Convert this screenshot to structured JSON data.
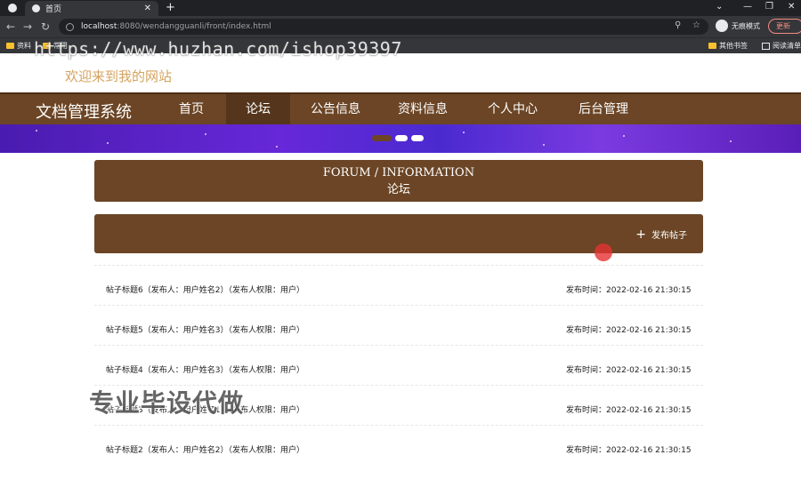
{
  "browser": {
    "tab_title": "首页",
    "tab_close": "✕",
    "new_tab": "+",
    "url_host": "localhost",
    "url_rest": ":8080/wendangguanli/front/index.html",
    "profile_label": "无痕模式",
    "update_label": "更新",
    "bookmarks": [
      "资料",
      "常用",
      "其他书签",
      "阅读清单"
    ],
    "window_controls": [
      "⌄",
      "—",
      "❐",
      "✕"
    ]
  },
  "watermark_url": "https://www.huzhan.com/ishop39397",
  "watermark_text": "专业毕设代做",
  "site": {
    "welcome": "欢迎来到我的网站",
    "brand": "文档管理系统",
    "nav": [
      {
        "label": "首页",
        "active": false
      },
      {
        "label": "论坛",
        "active": true
      },
      {
        "label": "公告信息",
        "active": false
      },
      {
        "label": "资料信息",
        "active": false
      },
      {
        "label": "个人中心",
        "active": false
      },
      {
        "label": "后台管理",
        "active": false
      }
    ]
  },
  "forum": {
    "title_en": "FORUM / INFORMATION",
    "title_zh": "论坛",
    "post_button": "发布帖子",
    "posts": [
      {
        "title": "帖子标题6（发布人：用户姓名2）（发布人权限：用户）",
        "time": "发布时间：2022-02-16 21:30:15"
      },
      {
        "title": "帖子标题5（发布人：用户姓名3）（发布人权限：用户）",
        "time": "发布时间：2022-02-16 21:30:15"
      },
      {
        "title": "帖子标题4（发布人：用户姓名3）（发布人权限：用户）",
        "time": "发布时间：2022-02-16 21:30:15"
      },
      {
        "title": "帖子标题3（发布人：用户姓名1）（发布人权限：用户）",
        "time": "发布时间：2022-02-16 21:30:15"
      },
      {
        "title": "帖子标题2（发布人：用户姓名2）（发布人权限：用户）",
        "time": "发布时间：2022-02-16 21:30:15"
      }
    ]
  },
  "colors": {
    "nav_bg": "#6b4525",
    "accent_text": "#d4a35f",
    "banner": "#5a22c8"
  }
}
